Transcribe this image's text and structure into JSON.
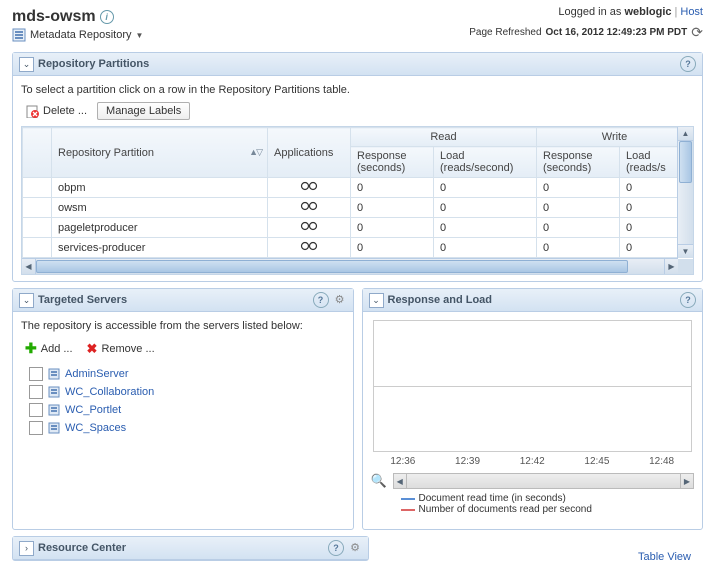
{
  "header": {
    "title": "mds-owsm",
    "sublabel": "Metadata Repository",
    "login_prefix": "Logged in as ",
    "user": "weblogic",
    "host_label": "Host",
    "refresh_prefix": "Page Refreshed ",
    "refresh_time": "Oct 16, 2012 12:49:23 PM PDT"
  },
  "partitions": {
    "title": "Repository Partitions",
    "hint": "To select a partition click on a row in the Repository Partitions table.",
    "delete_label": "Delete ...",
    "manage_label": "Manage Labels",
    "col_partition": "Repository Partition",
    "col_applications": "Applications",
    "group_read": "Read",
    "group_write": "Write",
    "col_response": "Response (seconds)",
    "col_load_read": "Load (reads/second)",
    "col_load_write": "Load (reads/s",
    "rows": [
      {
        "name": "obpm",
        "r1": "0",
        "r2": "0",
        "w1": "0",
        "w2": "0"
      },
      {
        "name": "owsm",
        "r1": "0",
        "r2": "0",
        "w1": "0",
        "w2": "0"
      },
      {
        "name": "pageletproducer",
        "r1": "0",
        "r2": "0",
        "w1": "0",
        "w2": "0"
      },
      {
        "name": "services-producer",
        "r1": "0",
        "r2": "0",
        "w1": "0",
        "w2": "0"
      }
    ]
  },
  "targeted": {
    "title": "Targeted Servers",
    "hint": "The repository is accessible from the servers listed below:",
    "add_label": "Add ...",
    "remove_label": "Remove ...",
    "servers": [
      "AdminServer",
      "WC_Collaboration",
      "WC_Portlet",
      "WC_Spaces"
    ]
  },
  "response": {
    "title": "Response and Load",
    "legend1": "Document read time (in seconds)",
    "legend2": "Number of documents read per second",
    "table_view": "Table View"
  },
  "chart_data": {
    "type": "line",
    "x": [
      "12:36",
      "12:39",
      "12:42",
      "12:45",
      "12:48"
    ],
    "series": [
      {
        "name": "Document read time (in seconds)",
        "values": [
          0,
          0,
          0,
          0,
          0
        ]
      },
      {
        "name": "Number of documents read per second",
        "values": [
          0,
          0,
          0,
          0,
          0
        ]
      }
    ],
    "title": "Response and Load",
    "xlabel": "",
    "ylabel": "",
    "ylim": [
      0,
      1
    ]
  },
  "resource": {
    "title": "Resource Center"
  }
}
